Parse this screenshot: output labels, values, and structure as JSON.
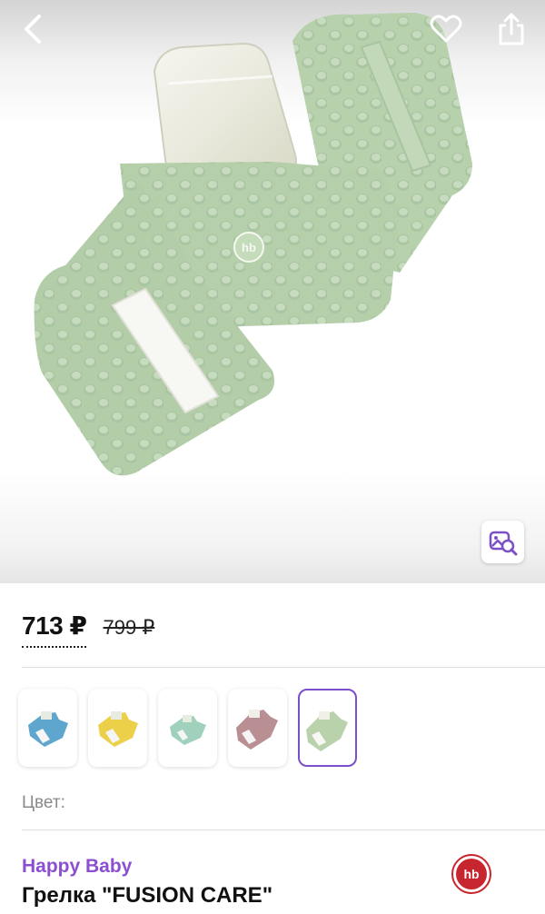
{
  "header": {
    "back_icon": "chevron-left-icon",
    "favorite_icon": "heart-icon",
    "share_icon": "share-icon"
  },
  "product_image": {
    "logo_text": "hb",
    "visual_search_icon": "image-search-icon"
  },
  "price": {
    "current": "713 ₽",
    "old": "799 ₽"
  },
  "colors": {
    "label": "Цвет:",
    "options": [
      {
        "name": "blue",
        "hex": "#5fa6cf"
      },
      {
        "name": "yellow",
        "hex": "#ecd04a"
      },
      {
        "name": "mint",
        "hex": "#9fd1bd"
      },
      {
        "name": "pink",
        "hex": "#b98f94"
      },
      {
        "name": "sage",
        "hex": "#b9d2ac"
      }
    ],
    "selected_index": 4
  },
  "brand": {
    "name": "Happy Baby",
    "logo_text": "hb",
    "color": "#8b4fd0"
  },
  "title": "Грелка \"FUSION CARE\"",
  "accent": "#7a4fc7"
}
